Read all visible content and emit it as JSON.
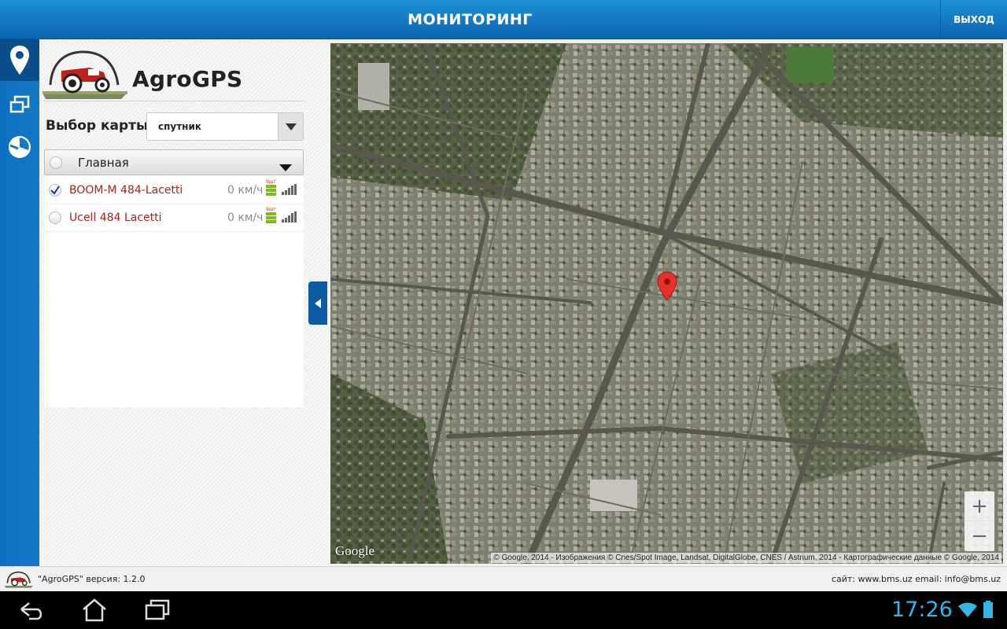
{
  "header": {
    "title": "МОНИТОРИНГ",
    "exit_label": "ВЫХОД"
  },
  "sidenav": {
    "items": [
      {
        "icon": "map-pin-icon",
        "active": true
      },
      {
        "icon": "windows-icon",
        "active": false
      },
      {
        "icon": "pie-chart-icon",
        "active": false
      }
    ]
  },
  "brand": {
    "name": "AgroGPS"
  },
  "map_select": {
    "label": "Выбор карты:",
    "value": "спутник"
  },
  "group": {
    "name": "Главная"
  },
  "vehicles": [
    {
      "name": "BOOM-M 484-Lacetti",
      "speed": "0 км/ч",
      "sat_count": "9шт",
      "checked": true
    },
    {
      "name": "Ucell 484 Lacetti",
      "speed": "0 км/ч",
      "sat_count": "9шт",
      "checked": false
    }
  ],
  "map": {
    "google_label": "Google",
    "attribution": "© Google, 2014 - Изображения © Cnes/Spot Image, Landsat, DigitalGlobe, CNES / Astrium, 2014 - Картографические данные © Google, 2014",
    "zoom_in": "+",
    "zoom_out": "−"
  },
  "footer": {
    "version_text": "\"AgroGPS\" версия: 1.2.0",
    "site_text": "сайт: www.bms.uz email: info@bms.uz"
  },
  "system": {
    "time": "17:26"
  },
  "colors": {
    "header_blue": "#0a66b2",
    "vehicle_text": "#a3251e",
    "clock": "#33b5e5",
    "sat_bar": "#7dbb1f"
  }
}
